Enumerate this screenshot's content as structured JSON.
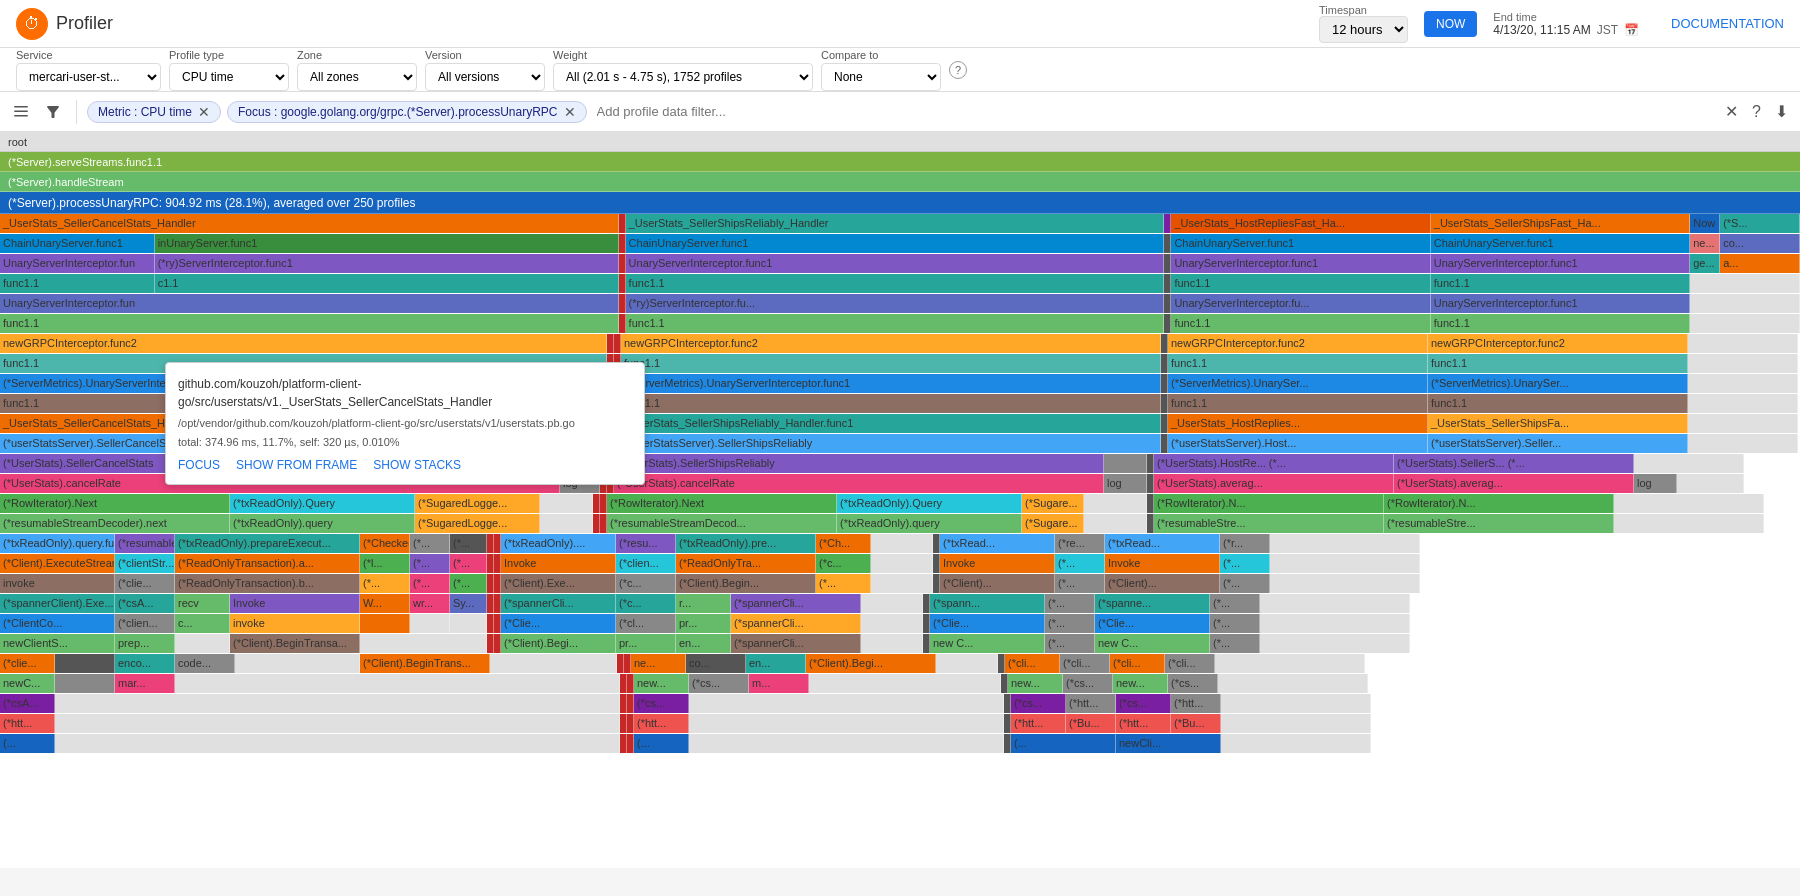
{
  "header": {
    "app_name": "Profiler",
    "timespan_label": "Timespan",
    "timespan_value": "12 hours",
    "now_btn": "NOW",
    "end_time_label": "End time",
    "end_time_value": "4/13/20, 11:15 AM",
    "timezone": "JST",
    "docs_link": "DOCUMENTATION"
  },
  "filters": {
    "service_label": "Service",
    "service_value": "mercari-user-st...",
    "profile_type_label": "Profile type",
    "profile_type_value": "CPU time",
    "zone_label": "Zone",
    "zone_value": "All zones",
    "version_label": "Version",
    "version_value": "All versions",
    "weight_label": "Weight",
    "weight_value": "All (2.01 s - 4.75 s), 1752 profiles",
    "compare_to_label": "Compare to",
    "compare_to_value": "None"
  },
  "filter_bar": {
    "chip_metric": "Metric : CPU time",
    "chip_focus": "Focus : google.golang.org/grpc.(*Server).processUnaryRPC",
    "placeholder": "Add profile data filter..."
  },
  "flame": {
    "root": "root",
    "serve": "(*Server).serveStreams.func1.1",
    "handle": "(*Server).handleStream",
    "process": "(*Server).processUnaryRPC: 904.92 ms (28.1%), averaged over 250 profiles"
  },
  "tooltip": {
    "title": "github.com/kouzoh/platform-client-go/src/userstats/v1._UserStats_SellerCancelStats_Handler",
    "path": "/opt/vendor/github.com/kouzoh/platform-client-go/src/userstats/v1/userstats.pb.go",
    "total": "total: 374.96 ms, 11.7%, self: 320 µs, 0.010%",
    "action1": "FOCUS",
    "action2": "SHOW FROM FRAME",
    "action3": "SHOW STACKS"
  },
  "colors": {
    "green1": "#8bc34a",
    "green2": "#66bb6a",
    "green3": "#4caf50",
    "teal": "#26a69a",
    "blue1": "#1565c0",
    "blue2": "#42a5f5",
    "blue3": "#1e88e5",
    "orange": "#ff7043",
    "orange2": "#ffa726",
    "purple": "#7e57c2",
    "amber": "#ffc107",
    "brown": "#8d6e63",
    "cyan": "#26c6da",
    "indigo": "#5c6bc0",
    "pink": "#ec407a",
    "lime": "#d4e157",
    "red": "#ef5350"
  }
}
